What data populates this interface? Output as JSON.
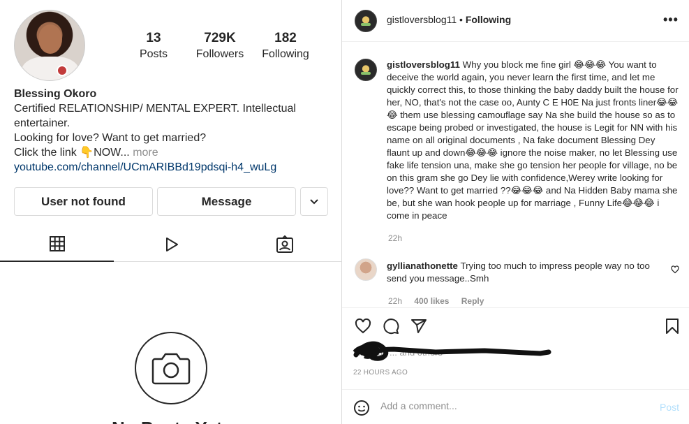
{
  "profile": {
    "name": "Blessing Okoro",
    "stats": [
      {
        "value": "13",
        "label": "Posts"
      },
      {
        "value": "729K",
        "label": "Followers"
      },
      {
        "value": "182",
        "label": "Following"
      }
    ],
    "bio_line1": "Certified RELATIONSHIP/ MENTAL EXPERT. Intellectual entertainer.",
    "bio_line2": "Looking for love? Want to get married?",
    "bio_line3": "Click the link 👇NOW...",
    "more_label": "more",
    "link": "youtube.com/channel/UCmARIBBd19pdsqi-h4_wuLg",
    "buttons": {
      "user_not_found": "User not found",
      "message": "Message"
    },
    "empty_title": "No Posts Yet"
  },
  "post": {
    "username": "gistloversblog11",
    "separator": "•",
    "follow_status": "Following",
    "caption_user": "gistloversblog11",
    "caption": "Why you block me fine girl 😂😂😂 You want to deceive the world again, you never learn the first time, and let me quickly correct this, to those thinking the baby daddy built the house for her, NO, that's not the case oo, Aunty C E H0E Na just fronts liner😂😂😂 them use blessing camouflage say Na she build the house so as to escape being probed or investigated, the house is Legit for NN with his name on all original documents , Na fake document Blessing Dey flaunt up and down😂😂😂 ignore the noise maker, no let Blessing use fake life tension una, make she go tension her people for village, no be on this gram she go Dey lie with confidence,Werey write looking for love?? Want to get married ??😂😂😂 and Na Hidden Baby mama she be, but she wan hook people up for marriage , Funny Life😂😂😂 i come in peace",
    "caption_time": "22h",
    "comment": {
      "username": "gyllianathonette",
      "text": "Trying too much to impress people way no too send you message..Smh",
      "time": "22h",
      "likes": "400 likes",
      "reply": "Reply"
    },
    "liked_by_partial": "Liked by ... and others",
    "time_ago": "22 HOURS AGO",
    "add_comment_placeholder": "Add a comment...",
    "post_label": "Post"
  },
  "icons": [
    "grid-icon",
    "reels-icon",
    "tagged-icon",
    "camera-icon",
    "heart-icon",
    "comment-icon",
    "share-icon",
    "bookmark-icon",
    "emoji-icon",
    "chevron-down-icon",
    "more-icon"
  ],
  "colors": {
    "link": "#00376b",
    "muted": "#8e8e8e",
    "post_button": "#b2dffc",
    "border": "#dbdbdb"
  }
}
